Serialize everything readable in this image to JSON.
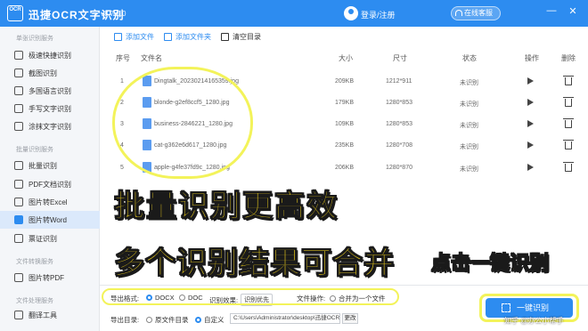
{
  "app": {
    "logo_text": "OCR",
    "title": "迅捷OCR文字识别",
    "version": "v8.7.0.0",
    "login": "登录/注册",
    "online_service": "在线客服",
    "win_min": "—",
    "win_close": "✕",
    "brand_color": "#2d8cf0"
  },
  "sidebar": {
    "group1": "单张识别服务",
    "items1": [
      "极速快捷识别",
      "截图识别",
      "多国语言识别",
      "手写文字识别",
      "涂抹文字识别"
    ],
    "group2": "批量识别服务",
    "items2": [
      "批量识别",
      "PDF文档识别",
      "图片转Excel",
      "图片转Word",
      "票证识别"
    ],
    "group3": "文件转换服务",
    "items3": [
      "图片转PDF"
    ],
    "group4": "文件处理服务",
    "items4": [
      "翻译工具"
    ],
    "active": "图片转Word"
  },
  "toolbar": {
    "add_file": "添加文件",
    "add_folder": "添加文件夹",
    "clear": "清空目录"
  },
  "table": {
    "headers": [
      "序号",
      "文件名",
      "大小",
      "尺寸",
      "状态",
      "操作",
      "删除"
    ],
    "rows": [
      {
        "no": "1",
        "name": "Dingtalk_20230214165359.jpg",
        "size": "209KB",
        "dim": "1212*911",
        "status": "未识别"
      },
      {
        "no": "2",
        "name": "blonde-g2ef8ccf5_1280.jpg",
        "size": "179KB",
        "dim": "1280*853",
        "status": "未识别"
      },
      {
        "no": "3",
        "name": "business-2846221_1280.jpg",
        "size": "109KB",
        "dim": "1280*853",
        "status": "未识别"
      },
      {
        "no": "4",
        "name": "cat-g362e6d617_1280.jpg",
        "size": "235KB",
        "dim": "1280*708",
        "status": "未识别"
      },
      {
        "no": "5",
        "name": "apple-g4fe37fd9c_1280.jpg",
        "size": "206KB",
        "dim": "1280*870",
        "status": "未识别"
      }
    ]
  },
  "overlay": {
    "line1": "批量识别更高效",
    "line2": "多个识别结果可合并",
    "line3": "点击一键识别"
  },
  "options": {
    "export_format_label": "导出格式:",
    "docx": "DOCX",
    "doc": "DOC",
    "effect_label": "识别效果:",
    "effect_value": "识别优先",
    "file_op_label": "文件操作:",
    "merge": "合并为一个文件",
    "out_dir_label": "导出目录:",
    "orig_dir": "原文件目录",
    "custom": "自定义",
    "path": "C:\\Users\\Administrator\\desktop\\迅捷OCR文",
    "change": "更改",
    "recognize": "一键识别"
  },
  "watermark": "知乎 @办公小帮手"
}
